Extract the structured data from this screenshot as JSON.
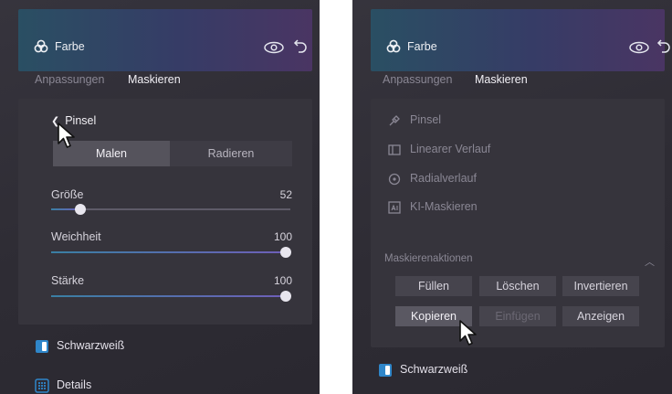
{
  "left_panel": {
    "header": {
      "title": "Farbe",
      "icons": [
        "palette-icon",
        "eye-icon",
        "undo-icon"
      ]
    },
    "tabs": [
      {
        "label": "Anpassungen",
        "active": false
      },
      {
        "label": "Maskieren",
        "active": true
      }
    ],
    "back_label": "Pinsel",
    "segmented": {
      "options": [
        "Malen",
        "Radieren"
      ],
      "selected": "Malen"
    },
    "sliders": [
      {
        "label": "Größe",
        "value": "52",
        "fraction": 0.13
      },
      {
        "label": "Weichheit",
        "value": "100",
        "fraction": 1.0
      },
      {
        "label": "Stärke",
        "value": "100",
        "fraction": 1.0
      }
    ],
    "sections": [
      {
        "label": "Schwarzweiß",
        "icon": "bw-icon"
      },
      {
        "label": "Details",
        "icon": "details-icon"
      }
    ]
  },
  "right_panel": {
    "header": {
      "title": "Farbe",
      "icons": [
        "palette-icon",
        "eye-icon",
        "undo-icon"
      ]
    },
    "tabs": [
      {
        "label": "Anpassungen",
        "active": false
      },
      {
        "label": "Maskieren",
        "active": true
      }
    ],
    "tools": [
      {
        "label": "Pinsel",
        "icon": "brush-icon"
      },
      {
        "label": "Linearer Verlauf",
        "icon": "linear-gradient-icon"
      },
      {
        "label": "Radialverlauf",
        "icon": "radial-gradient-icon"
      },
      {
        "label": "KI-Maskieren",
        "icon": "ai-mask-icon"
      }
    ],
    "actions": {
      "title": "Maskierenaktionen",
      "buttons": [
        {
          "label": "Füllen",
          "state": "normal"
        },
        {
          "label": "Löschen",
          "state": "normal"
        },
        {
          "label": "Invertieren",
          "state": "normal"
        },
        {
          "label": "Kopieren",
          "state": "hover"
        },
        {
          "label": "Einfügen",
          "state": "disabled"
        },
        {
          "label": "Anzeigen",
          "state": "normal"
        }
      ]
    },
    "sections": [
      {
        "label": "Schwarzweiß",
        "icon": "bw-icon"
      }
    ]
  },
  "colors": {
    "panel_bg": "#302e36",
    "inner_bg": "#36343c",
    "header_gradient": [
      "#2a4f63",
      "#363c66",
      "#4a3563"
    ],
    "accent_blue": "#2f86c9",
    "slider_fill": [
      "#3a7fa3",
      "#6e5fb8"
    ]
  }
}
